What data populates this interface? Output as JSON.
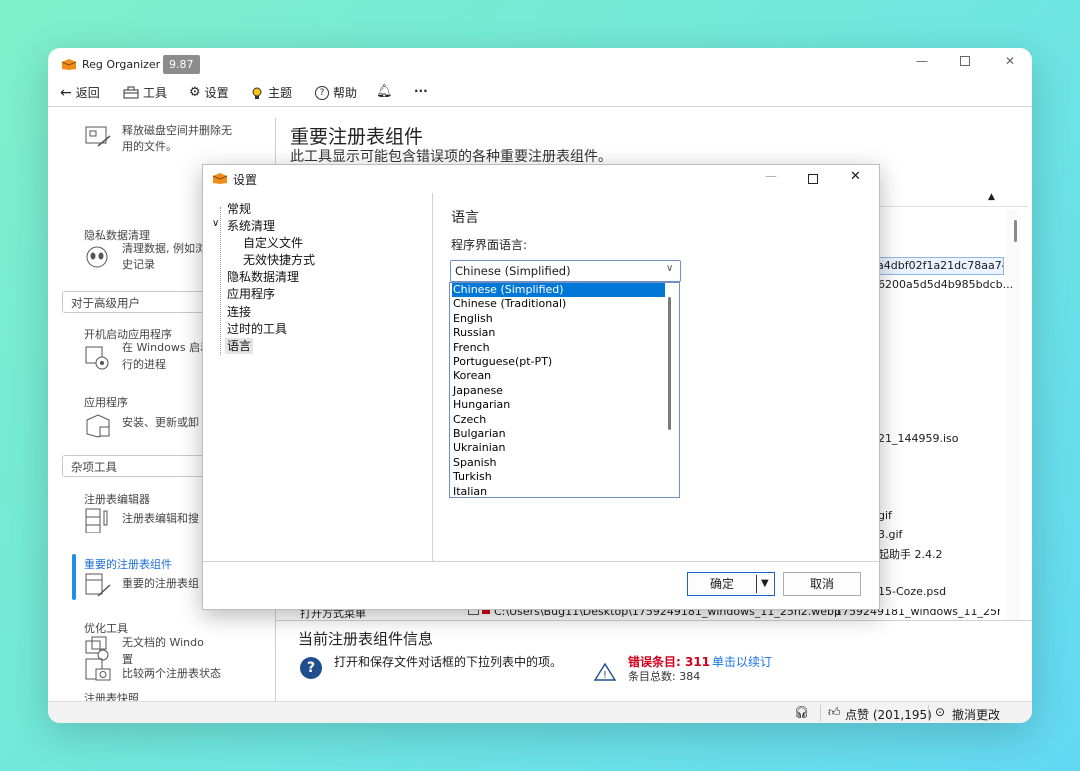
{
  "app": {
    "title": "Reg Organizer",
    "version": "9.87"
  },
  "toolbar": {
    "back": "返回",
    "tools": "工具",
    "settings": "设置",
    "theme": "主题",
    "help": "帮助",
    "more": "···"
  },
  "sidebar": {
    "disk": {
      "text": "释放磁盘空间并删除无用的文件。"
    },
    "privacy": {
      "title": "隐私数据清理",
      "line1": "清理数据, 例如浏",
      "line2": "史记录"
    },
    "advanced_group": "对于高级用户",
    "startup": {
      "title": "开机启动应用程序",
      "line1": "在 Windows 启动",
      "line2": "行的进程"
    },
    "apps": {
      "title": "应用程序",
      "line1": "安装、更新或卸"
    },
    "misc_group": "杂项工具",
    "regedit": {
      "title": "注册表编辑器",
      "line1": "注册表编辑和搜"
    },
    "important": {
      "title": "重要的注册表组件",
      "line1": "重要的注册表组"
    },
    "optimize": {
      "title": "优化工具",
      "line1": "无文档的 Windo",
      "line2": "置"
    },
    "snapshot": {
      "title": "注册表快照",
      "line1": "比较两个注册表状态"
    }
  },
  "main": {
    "title": "重要注册表组件",
    "subtitle": "此工具显示可能包含错误项的各种重要注册表组件。",
    "right_items": [
      "a4dbf02f1a21dc78aa74...",
      "6200a5d5d4b985bdcb...",
      "21_144959.iso",
      "gif",
      "3.gif",
      "起助手 2.4.2",
      "15-Coze.psd"
    ],
    "bottom_row_left": "打开方式菜单",
    "bottom_row_path": "C:\\Users\\Bug11\\Desktop\\1759249181_windows_11_25h2.webp",
    "bottom_row_right": "1759249181_windows_11_25h2....",
    "info_title": "当前注册表组件信息",
    "info_desc": "打开和保存文件对话框的下拉列表中的项。",
    "error_label": "错误条目: 311",
    "error_link": "单击以续订",
    "total": "条目总数: 384"
  },
  "status": {
    "like": "点赞 (201,195)",
    "undo": "撤消更改"
  },
  "dialog": {
    "title": "设置",
    "tree": [
      "常规",
      "系统清理",
      "自定义文件",
      "无效快捷方式",
      "隐私数据清理",
      "应用程序",
      "连接",
      "过时的工具",
      "语言"
    ],
    "section_title": "语言",
    "field_label": "程序界面语言:",
    "selected_language": "Chinese (Simplified)",
    "options": [
      "Chinese (Simplified)",
      "Chinese (Traditional)",
      "English",
      "Russian",
      "French",
      "Portuguese(pt-PT)",
      "Korean",
      "Japanese",
      "Hungarian",
      "Czech",
      "Bulgarian",
      "Ukrainian",
      "Spanish",
      "Turkish",
      "Italian"
    ],
    "ok": "确定",
    "cancel": "取消"
  },
  "colors": {
    "accent": "#1e90e6",
    "highlight": "#0078d7",
    "error": "#d0021b",
    "link": "#1a73e8"
  }
}
